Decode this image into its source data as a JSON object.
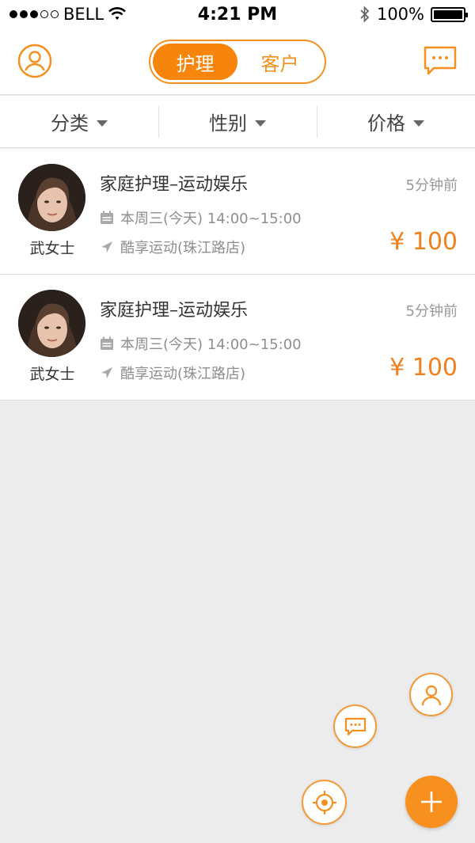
{
  "status_bar": {
    "carrier": "BELL",
    "time": "4:21 PM",
    "battery": "100%",
    "signal_bars_filled": 3,
    "signal_bars_total": 5
  },
  "nav": {
    "profile_icon": "user-circle-icon",
    "message_icon": "chat-bubble-icon",
    "tabs": [
      {
        "label": "护理",
        "active": true
      },
      {
        "label": "客户",
        "active": false
      }
    ]
  },
  "filters": [
    {
      "label": "分类"
    },
    {
      "label": "性别"
    },
    {
      "label": "价格"
    }
  ],
  "listings": [
    {
      "title": "家庭护理–运动娱乐",
      "time_ago": "5分钟前",
      "schedule": "本周三(今天) 14:00~15:00",
      "location": "酷享运动(珠江路店)",
      "price": "¥ 100",
      "user_name": "武女士"
    },
    {
      "title": "家庭护理–运动娱乐",
      "time_ago": "5分钟前",
      "schedule": "本周三(今天) 14:00~15:00",
      "location": "酷享运动(珠江路店)",
      "price": "¥ 100",
      "user_name": "武女士"
    }
  ],
  "fabs": {
    "user": "user-icon",
    "chat": "chat-icon",
    "locate": "crosshair-icon",
    "add": "plus-icon"
  },
  "colors": {
    "accent": "#f7850c",
    "price": "#f08020",
    "background": "#ececec"
  }
}
